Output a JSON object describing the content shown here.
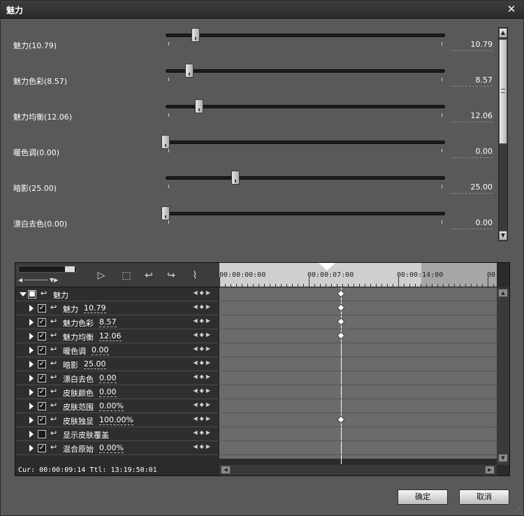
{
  "window": {
    "title": "魅力",
    "close_label": "✕"
  },
  "params": [
    {
      "label": "魅力(10.79)",
      "value": "10.79",
      "level": 10.79,
      "max": 100
    },
    {
      "label": "魅力色彩(8.57)",
      "value": "8.57",
      "level": 8.57,
      "max": 100
    },
    {
      "label": "魅力均衡(12.06)",
      "value": "12.06",
      "level": 12.06,
      "max": 100
    },
    {
      "label": "暖色调(0.00)",
      "value": "0.00",
      "level": 0,
      "max": 100
    },
    {
      "label": "暗影(25.00)",
      "value": "25.00",
      "level": 25.0,
      "max": 100
    },
    {
      "label": "漂白去色(0.00)",
      "value": "0.00",
      "level": 0,
      "max": 100
    }
  ],
  "timeline": {
    "ruler_labels": [
      "00:00:00:00",
      "00:00:07:00",
      "00:00:14:00",
      "00"
    ],
    "tracks": [
      {
        "name": "魅力",
        "value": "",
        "root": true,
        "checked": "■",
        "has_key": true
      },
      {
        "name": "魅力",
        "value": "10.79",
        "checked": "✓",
        "has_key": true
      },
      {
        "name": "魅力色彩",
        "value": "8.57",
        "checked": "✓",
        "has_key": true
      },
      {
        "name": "魅力均衡",
        "value": "12.06",
        "checked": "✓",
        "has_key": true
      },
      {
        "name": "暖色调",
        "value": "0.00",
        "checked": "✓",
        "has_key": false
      },
      {
        "name": "暗影",
        "value": "25.00",
        "checked": "✓",
        "has_key": false
      },
      {
        "name": "漂白去色",
        "value": "0.00",
        "checked": "✓",
        "has_key": false
      },
      {
        "name": "皮肤颜色",
        "value": "0.00",
        "checked": "✓",
        "has_key": false
      },
      {
        "name": "皮肤范围",
        "value": "0.00%",
        "checked": "✓",
        "has_key": false
      },
      {
        "name": "皮肤独显",
        "value": "100.00%",
        "checked": "✓",
        "has_key": true
      },
      {
        "name": "显示皮肤覆盖",
        "value": "",
        "checked": "",
        "has_key": false
      },
      {
        "name": "混合原始",
        "value": "0.00%",
        "checked": "✓",
        "has_key": false
      }
    ],
    "status": "Cur: 00:00:09:14  Ttl: 13:19:50:01"
  },
  "buttons": {
    "ok": "确定",
    "cancel": "取消"
  }
}
